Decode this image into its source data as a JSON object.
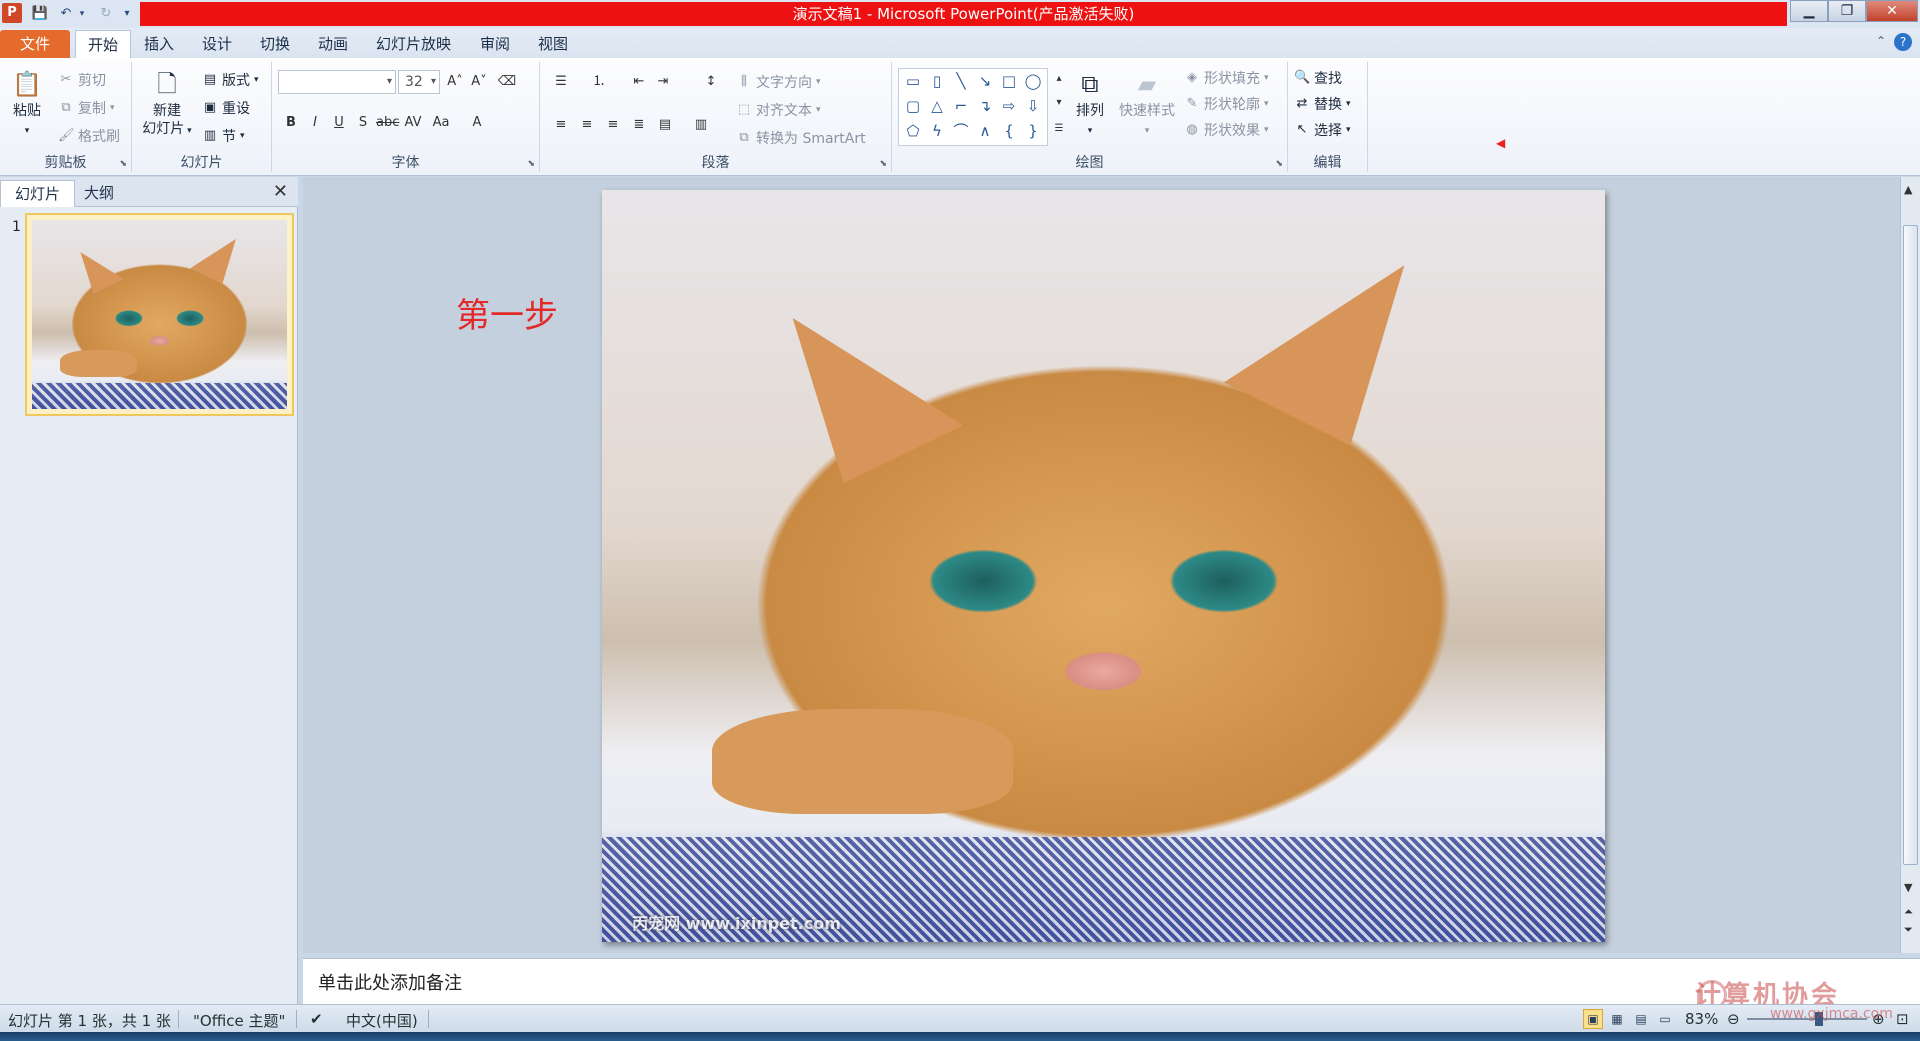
{
  "window": {
    "title": "演示文稿1 - Microsoft PowerPoint(产品激活失败)",
    "app_icon": "P"
  },
  "tabs": [
    {
      "label": "文件"
    },
    {
      "label": "开始"
    },
    {
      "label": "插入"
    },
    {
      "label": "设计"
    },
    {
      "label": "切换"
    },
    {
      "label": "动画"
    },
    {
      "label": "幻灯片放映"
    },
    {
      "label": "审阅"
    },
    {
      "label": "视图"
    }
  ],
  "ribbon": {
    "clipboard": {
      "label": "剪贴板",
      "paste": "粘贴",
      "cut": "剪切",
      "copy": "复制",
      "format_painter": "格式刷"
    },
    "slides": {
      "label": "幻灯片",
      "new_slide_1": "新建",
      "new_slide_2": "幻灯片",
      "layout": "版式",
      "reset": "重设",
      "section": "节"
    },
    "font": {
      "label": "字体",
      "font_size": "32"
    },
    "paragraph": {
      "label": "段落",
      "text_direction": "文字方向",
      "align_text": "对齐文本",
      "smartart": "转换为 SmartArt"
    },
    "drawing": {
      "label": "绘图",
      "arrange": "排列",
      "quick_styles": "快速样式",
      "shape_fill": "形状填充",
      "shape_outline": "形状轮廓",
      "shape_effects": "形状效果"
    },
    "editing": {
      "label": "编辑",
      "find": "查找",
      "replace": "替换",
      "select": "选择"
    }
  },
  "left_panel": {
    "tab_slides": "幻灯片",
    "tab_outline": "大纲",
    "slide_number": "1"
  },
  "slide": {
    "annotation": "第一步",
    "image_watermark": "丙宠网 www.ixinpet.com"
  },
  "notes": {
    "placeholder": "单击此处添加备注"
  },
  "status": {
    "slide_info": "幻灯片 第 1 张，共 1 张",
    "theme": "\"Office 主题\"",
    "language": "中文(中国)",
    "zoom": "83%"
  },
  "logo": {
    "text": "计算机协会",
    "url": "www.gxjmca.com"
  },
  "colors": {
    "title_bar_red": "#ee1111",
    "file_tab": "#e46b2b",
    "annotation_red": "#e32a2a"
  }
}
